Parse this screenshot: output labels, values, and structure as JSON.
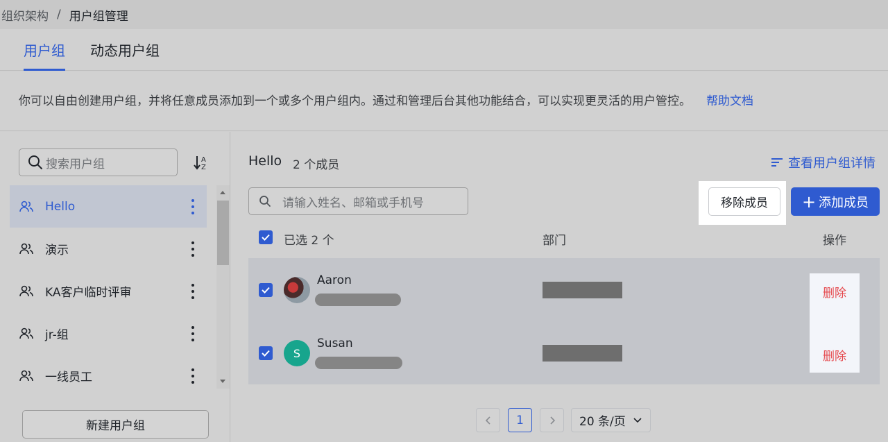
{
  "breadcrumb": {
    "parent": "组织架构",
    "separator": "/",
    "current": "用户组管理"
  },
  "tabs": [
    {
      "label": "用户组",
      "active": true
    },
    {
      "label": "动态用户组",
      "active": false
    }
  ],
  "description": {
    "text": "你可以自由创建用户组，并将任意成员添加到一个或多个用户组内。通过和管理后台其他功能结合，可以实现更灵活的用户管控。",
    "link": "帮助文档"
  },
  "sidebar": {
    "search_placeholder": "搜索用户组",
    "sort_icon": "sort-alpha-icon",
    "groups": [
      {
        "name": "Hello",
        "active": true
      },
      {
        "name": "演示",
        "active": false
      },
      {
        "name": "KA客户临时评审",
        "active": false
      },
      {
        "name": "jr-组",
        "active": false
      },
      {
        "name": "一线员工",
        "active": false
      }
    ],
    "new_group_label": "新建用户组"
  },
  "main": {
    "group_name": "Hello",
    "member_count": "2 个成员",
    "detail_link": "查看用户组详情",
    "search_placeholder": "请输入姓名、邮箱或手机号",
    "remove_label": "移除成员",
    "add_label": "添加成员",
    "table": {
      "selected_label": "已选 2 个",
      "columns": {
        "department": "部门",
        "actions": "操作"
      },
      "rows": [
        {
          "name": "Aaron",
          "avatar": "photo",
          "checked": true,
          "action": "删除"
        },
        {
          "name": "Susan",
          "avatar": "S",
          "checked": true,
          "action": "删除"
        }
      ]
    },
    "pagination": {
      "current_page": "1",
      "page_size": "20 条/页"
    }
  },
  "colors": {
    "primary": "#2f5bd0",
    "danger": "#e5484d",
    "avatar_green": "#17a58d"
  }
}
